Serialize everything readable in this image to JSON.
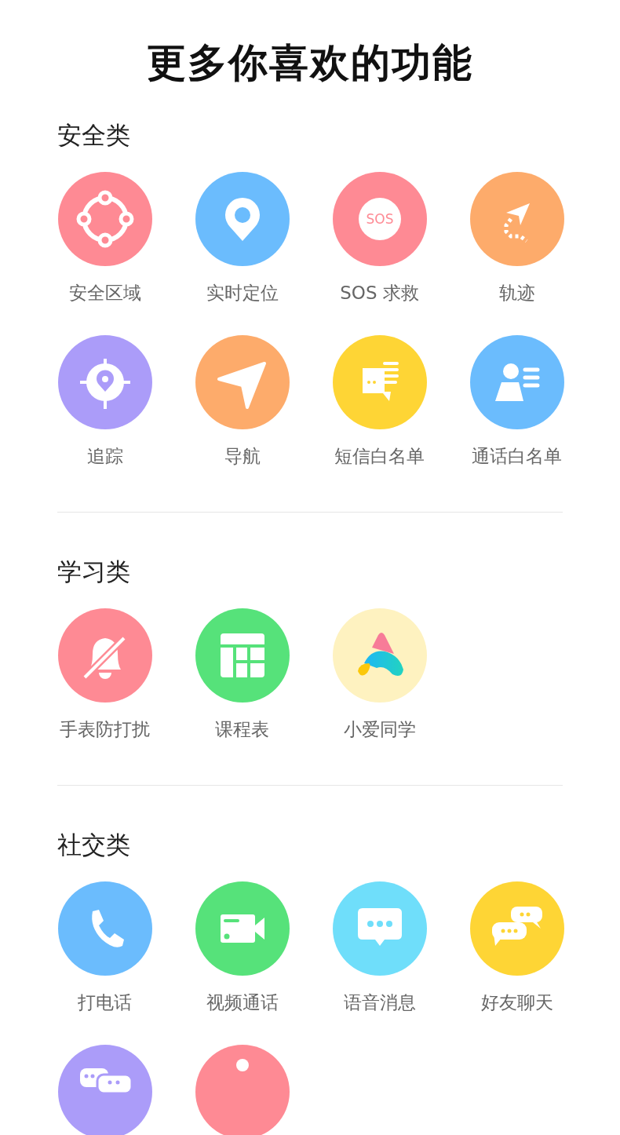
{
  "title": "更多你喜欢的功能",
  "sections": [
    {
      "title": "安全类",
      "items": [
        {
          "kind": "safe-zone",
          "color": "#fe8a94",
          "label": "安全区域"
        },
        {
          "kind": "location",
          "color": "#6bbcfd",
          "label": "实时定位"
        },
        {
          "kind": "sos",
          "color": "#fe8a94",
          "label": "SOS 求救",
          "icon_text": "SOS"
        },
        {
          "kind": "track",
          "color": "#fdab6b",
          "label": "轨迹"
        },
        {
          "kind": "tracking",
          "color": "#ab9cf9",
          "label": "追踪"
        },
        {
          "kind": "navigation",
          "color": "#fdab6b",
          "label": "导航"
        },
        {
          "kind": "sms-list",
          "color": "#fed535",
          "label": "短信白名单"
        },
        {
          "kind": "contact-list",
          "color": "#6bbcfd",
          "label": "通话白名单"
        }
      ]
    },
    {
      "title": "学习类",
      "items": [
        {
          "kind": "do-not-disturb",
          "color": "#fe8a94",
          "label": "手表防打扰"
        },
        {
          "kind": "timetable",
          "color": "#56e27a",
          "label": "课程表"
        },
        {
          "kind": "assistant",
          "color": "#fef2c0",
          "label": "小爱同学"
        }
      ]
    },
    {
      "title": "社交类",
      "items": [
        {
          "kind": "phone",
          "color": "#6bbcfd",
          "label": "打电话"
        },
        {
          "kind": "video",
          "color": "#56e27a",
          "label": "视频通话"
        },
        {
          "kind": "voice-message",
          "color": "#6fdefa",
          "label": "语音消息"
        },
        {
          "kind": "friend-chat",
          "color": "#fed535",
          "label": "好友聊天"
        },
        {
          "kind": "group-chat",
          "color": "#ab9cf9"
        },
        {
          "kind": "dot",
          "color": "#fe8a94"
        }
      ]
    }
  ]
}
